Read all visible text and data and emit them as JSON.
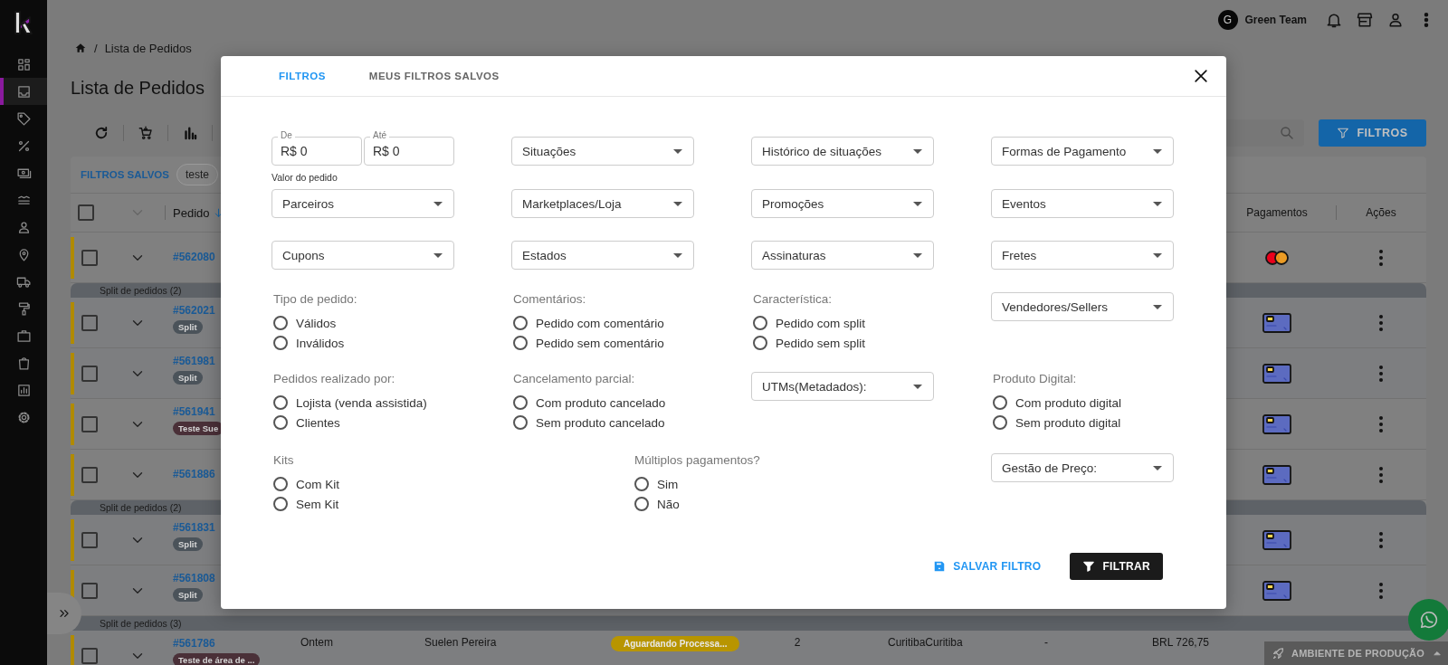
{
  "topbar": {
    "avatar": "G",
    "team": "Green Team"
  },
  "sidebar": {
    "items": [
      {
        "selected": false
      },
      {
        "selected": true
      },
      {
        "selected": false
      },
      {
        "selected": false
      },
      {
        "selected": false
      },
      {
        "selected": false
      },
      {
        "selected": false
      },
      {
        "selected": false
      },
      {
        "selected": false
      },
      {
        "selected": false
      },
      {
        "selected": false
      },
      {
        "selected": false
      },
      {
        "selected": false
      },
      {
        "selected": false
      }
    ]
  },
  "breadcrumb": {
    "separator": "/",
    "current": "Lista de Pedidos"
  },
  "page_title": "Lista de Pedidos",
  "filters_button": "FILTROS",
  "saved_filters": {
    "label": "FILTROS SALVOS",
    "chips": [
      "teste"
    ]
  },
  "table": {
    "select_all_checked": false,
    "columns": [
      {
        "label": "Pedido",
        "sorted": true
      },
      {
        "label": "Pagamentos",
        "sorted": false
      },
      {
        "label": "Ações",
        "sorted": false
      }
    ],
    "rows": [
      {
        "kind": "order",
        "id": "#562080",
        "checked": false,
        "payment": {
          "kind": "mastercard"
        },
        "menu": true
      },
      {
        "kind": "group",
        "label": "Split de pedidos (2)",
        "children": [
          {
            "kind": "order",
            "id": "#562021",
            "checked": false,
            "badge": {
              "text": "Split",
              "color": "#4b535a"
            },
            "payment": {
              "kind": "card"
            },
            "menu": true
          },
          {
            "kind": "order",
            "id": "#561981",
            "checked": false,
            "badge": {
              "text": "Split",
              "color": "#4b535a"
            },
            "payment": {
              "kind": "card"
            },
            "menu": true
          }
        ]
      },
      {
        "kind": "order",
        "id": "#561941",
        "checked": false,
        "badge": {
          "text": "Teste Sue",
          "color": "#4a3038"
        },
        "payment": {
          "kind": "card"
        },
        "menu": true
      },
      {
        "kind": "order",
        "id": "#561886",
        "checked": false,
        "payment": {
          "kind": "card"
        },
        "menu": true
      },
      {
        "kind": "group",
        "label": "Split de pedidos (2)",
        "children": [
          {
            "kind": "order",
            "id": "#561831",
            "checked": false,
            "badge": {
              "text": "Split",
              "color": "#4b535a"
            },
            "payment": {
              "kind": "card"
            },
            "menu": true
          },
          {
            "kind": "order",
            "id": "#561808",
            "checked": false,
            "badge": {
              "text": "Split",
              "color": "#4b535a"
            },
            "payment": {
              "kind": "card"
            },
            "menu": true
          }
        ]
      },
      {
        "kind": "group",
        "label": "Split de pedidos (3)",
        "children": [
          {
            "kind": "order",
            "id": "#561786",
            "checked": false,
            "badge": {
              "text": "Teste de área de ...",
              "color": "#4a3038"
            },
            "menu": false,
            "cells": [
              {
                "kind": "text",
                "text": "Ontem"
              },
              {
                "kind": "text",
                "text": "Suelen Pereira"
              },
              {
                "kind": "status",
                "text": "Aguardando Processa...",
                "color": "#b89500"
              },
              {
                "kind": "number",
                "text": "2"
              },
              {
                "kind": "text",
                "text": "CuritibaCuritiba"
              },
              {
                "kind": "number",
                "text": "-"
              },
              {
                "kind": "amount",
                "text": "BRL 726,75"
              }
            ]
          }
        ]
      }
    ]
  },
  "modal": {
    "tabs": [
      {
        "label": "FILTROS",
        "selected": true
      },
      {
        "label": "MEUS FILTROS SALVOS",
        "selected": false
      }
    ],
    "rows": [
      [
        {
          "kind": "range",
          "from": {
            "label": "De",
            "value": "R$ 0"
          },
          "to": {
            "label": "Até",
            "value": "R$ 0"
          },
          "caption": "Valor do pedido"
        },
        {
          "kind": "select",
          "label": "Situações"
        },
        {
          "kind": "select",
          "label": "Histórico de situações"
        },
        {
          "kind": "select",
          "label": "Formas de Pagamento"
        }
      ],
      [
        {
          "kind": "select",
          "label": "Parceiros"
        },
        {
          "kind": "select",
          "label": "Marketplaces/Loja"
        },
        {
          "kind": "select",
          "label": "Promoções"
        },
        {
          "kind": "select",
          "label": "Eventos"
        }
      ],
      [
        {
          "kind": "select",
          "label": "Cupons"
        },
        {
          "kind": "select",
          "label": "Estados"
        },
        {
          "kind": "select",
          "label": "Assinaturas"
        },
        {
          "kind": "select",
          "label": "Fretes"
        }
      ],
      [
        {
          "kind": "radio_group",
          "title": "Tipo de pedido:",
          "options": [
            {
              "label": "Válidos",
              "selected": false
            },
            {
              "label": "Inválidos",
              "selected": false
            }
          ]
        },
        {
          "kind": "radio_group",
          "title": "Comentários:",
          "options": [
            {
              "label": "Pedido com comentário",
              "selected": false
            },
            {
              "label": "Pedido sem comentário",
              "selected": false
            }
          ]
        },
        {
          "kind": "radio_group",
          "title": "Característica:",
          "options": [
            {
              "label": "Pedido com split",
              "selected": false
            },
            {
              "label": "Pedido sem split",
              "selected": false
            }
          ]
        },
        {
          "kind": "select",
          "label": "Vendedores/Sellers"
        }
      ],
      [
        {
          "kind": "radio_group",
          "title": "Pedidos realizado por:",
          "options": [
            {
              "label": "Lojista (venda assistida)",
              "selected": false
            },
            {
              "label": "Clientes",
              "selected": false
            }
          ]
        },
        {
          "kind": "radio_group",
          "title": "Cancelamento parcial:",
          "options": [
            {
              "label": "Com produto cancelado",
              "selected": false
            },
            {
              "label": "Sem produto cancelado",
              "selected": false
            }
          ]
        },
        {
          "kind": "select",
          "label": "UTMs(Metadados):"
        },
        {
          "kind": "radio_group",
          "title": "Produto Digital:",
          "options": [
            {
              "label": "Com produto digital",
              "selected": false
            },
            {
              "label": "Sem produto digital",
              "selected": false
            }
          ]
        }
      ],
      [
        {
          "kind": "radio_group",
          "title": "Kits",
          "options": [
            {
              "label": "Com Kit",
              "selected": false
            },
            {
              "label": "Sem Kit",
              "selected": false
            }
          ]
        },
        {
          "kind": "radio_group",
          "title": "Múltiplos pagamentos?",
          "options": [
            {
              "label": "Sim",
              "selected": false
            },
            {
              "label": "Não",
              "selected": false
            }
          ]
        },
        "",
        {
          "kind": "select",
          "label": "Gestão de Preço:"
        }
      ]
    ],
    "save_button": "SALVAR FILTRO",
    "apply_button": "FILTRAR"
  },
  "environment_bar": "AMBIENTE DE PRODUÇÃO"
}
